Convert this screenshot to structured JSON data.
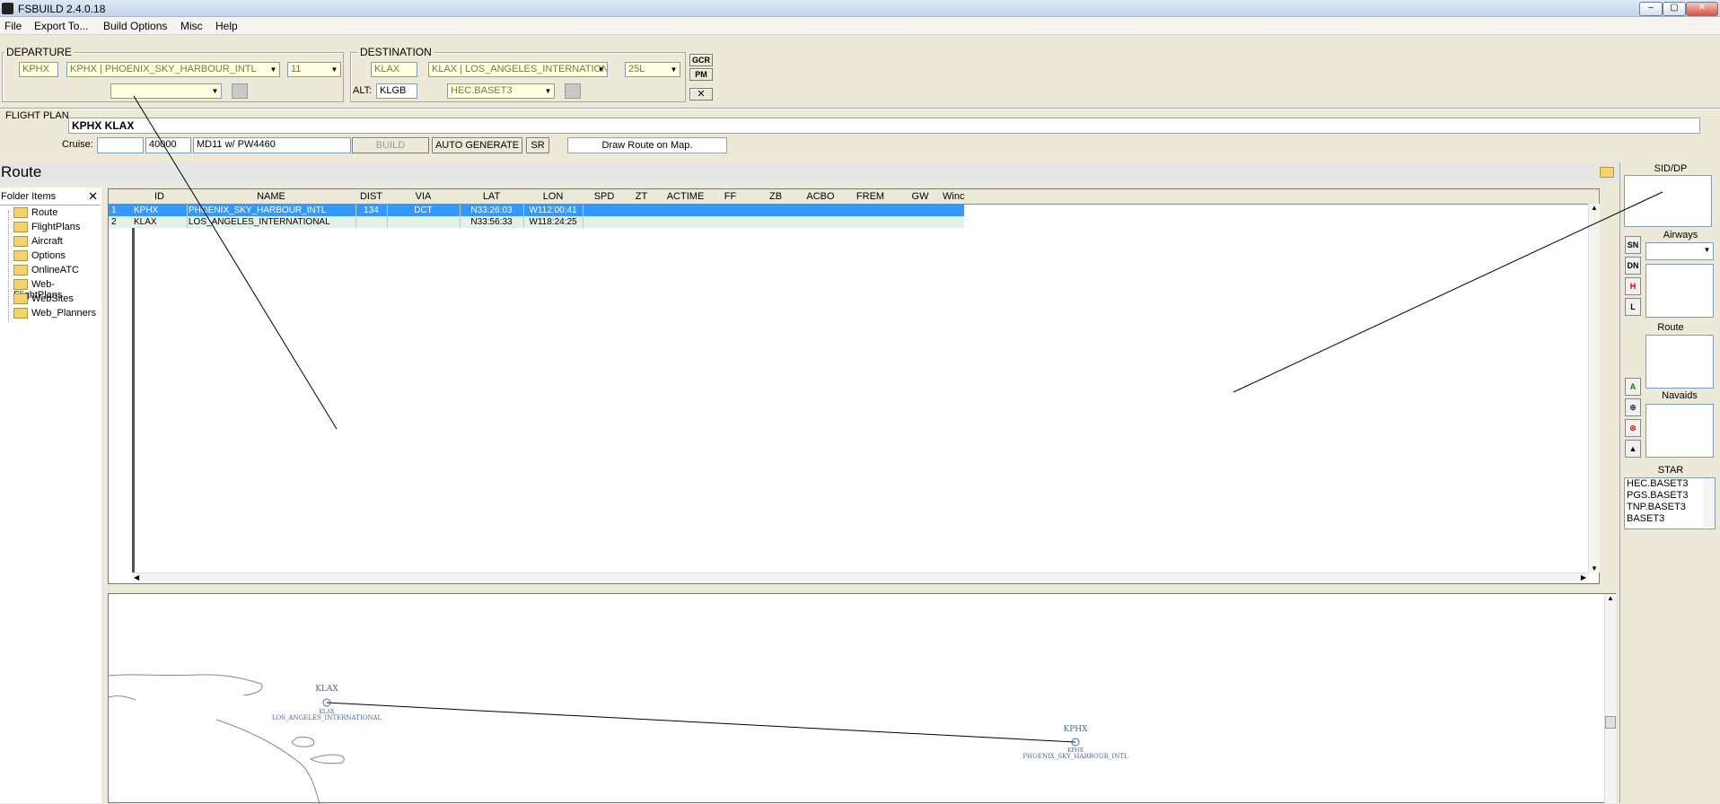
{
  "app": {
    "title": "FSBUILD 2.4.0.18"
  },
  "window_buttons": {
    "minimize": "‒",
    "maximize": "▢",
    "close": "✕"
  },
  "menu": [
    "File",
    "Export To...",
    "Build Options",
    "Misc",
    "Help"
  ],
  "departure": {
    "label": "DEPARTURE",
    "icao": "KPHX",
    "airport": "KPHX | PHOENIX_SKY_HARBOUR_INTL",
    "runway": "11",
    "sid": ""
  },
  "destination": {
    "label": "DESTINATION",
    "icao": "KLAX",
    "airport": "KLAX | LOS_ANGELES_INTERNATION",
    "runway": "25L",
    "alt_label": "ALT:",
    "alternate": "KLGB",
    "star": "HEC.BASET3"
  },
  "side_buttons": {
    "gcr": "GCR",
    "pm": "PM",
    "close": "✕"
  },
  "flight_plan": {
    "label": "FLIGHT PLAN",
    "route_string": "KPHX  KLAX",
    "cruise_label": "Cruise:",
    "cruise_speed": "",
    "cruise_alt": "40000",
    "aircraft": "MD11 w/ PW4460",
    "build_btn": "BUILD",
    "autogen_btn": "AUTO GENERATE",
    "sr_btn": "SR",
    "draw_route_btn": "Draw Route on Map."
  },
  "route_section": {
    "title": "Route"
  },
  "folder": {
    "header": "Folder Items",
    "close": "✕",
    "items": [
      "Route",
      "FlightPlans",
      "Aircraft",
      "Options",
      "OnlineATC",
      "Web-FlightPlans",
      "WebSites",
      "Web_Planners"
    ]
  },
  "grid": {
    "columns": [
      "ID",
      "NAME",
      "DIST",
      "VIA",
      "LAT",
      "LON",
      "",
      "SPD",
      "ZT",
      "ACTIME",
      "FF",
      "ZB",
      "ACBO",
      "FREM",
      "GW",
      "Winc"
    ],
    "rows": [
      {
        "num": "1",
        "id": "KPHX",
        "name": "PHOENIX_SKY_HARBOUR_INTL",
        "dist": "134",
        "via": "DCT",
        "lat": "N33:26:03",
        "lon": "W112:00:41"
      },
      {
        "num": "2",
        "id": "KLAX",
        "name": "LOS_ANGELES_INTERNATIONAL",
        "dist": "",
        "via": "",
        "lat": "N33:56:33",
        "lon": "W118:24:25"
      }
    ]
  },
  "right_panel": {
    "sid_label": "SID/DP",
    "airways_label": "Airways",
    "route_label": "Route",
    "navaids_label": "Navaids",
    "star_label": "STAR",
    "star_items": [
      "HEC.BASET3",
      "PGS.BASET3",
      "TNP.BASET3",
      "BASET3"
    ],
    "tools": [
      "SN",
      "DN",
      "H",
      "L"
    ],
    "tools2": [
      "A",
      "⊕",
      "⊗",
      "▲"
    ]
  },
  "map": {
    "klax_label": "KLAX",
    "klax_sub1": "KLAX",
    "klax_sub2": "LOS_ANGELES_INTERNATIONAL",
    "kphx_label": "KPHX",
    "kphx_sub1": "KPHX",
    "kphx_sub2": "PHOENIX_SKY_HARBOUR_INTL"
  },
  "colors": {
    "selection": "#3399ff",
    "row_alt": "#e3f1e9",
    "field_yellow": "#ffffe0",
    "map_blue": "#4a6a9a"
  }
}
